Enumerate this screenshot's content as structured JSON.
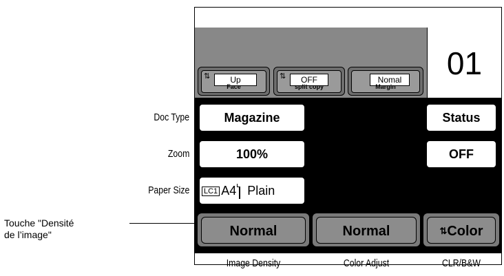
{
  "callout": {
    "text_line1": "Touche \"Densité",
    "text_line2": "de l’image\""
  },
  "counter": {
    "value": "01"
  },
  "top_settings": [
    {
      "value": "Up",
      "caption": "Face",
      "icon": "cycle-arrows-icon"
    },
    {
      "value": "OFF",
      "caption": "split copy",
      "icon": "cycle-arrows-icon"
    },
    {
      "value": "Nomal",
      "caption": "Margin"
    }
  ],
  "rows": {
    "doc_type": {
      "label": "Doc Type",
      "value": "Magazine"
    },
    "zoom": {
      "label": "Zoom",
      "value": "100%"
    },
    "paper_size": {
      "label": "Paper Size",
      "tray": "LC1",
      "size": "A4",
      "media": "Plain"
    }
  },
  "right_buttons": {
    "status": "Status",
    "off": "OFF"
  },
  "bottom_buttons": {
    "image_density": "Normal",
    "color_adjust": "Normal",
    "color_mode": "Color"
  },
  "bottom_labels": {
    "image_density": "Image Density",
    "color_adjust": "Color Adjust",
    "clr_bw": "CLR/B&W"
  },
  "colors": {
    "panel_gray": "#888888",
    "button_gray": "#8c8c8c",
    "background": "#ffffff",
    "screen_black": "#000000"
  }
}
